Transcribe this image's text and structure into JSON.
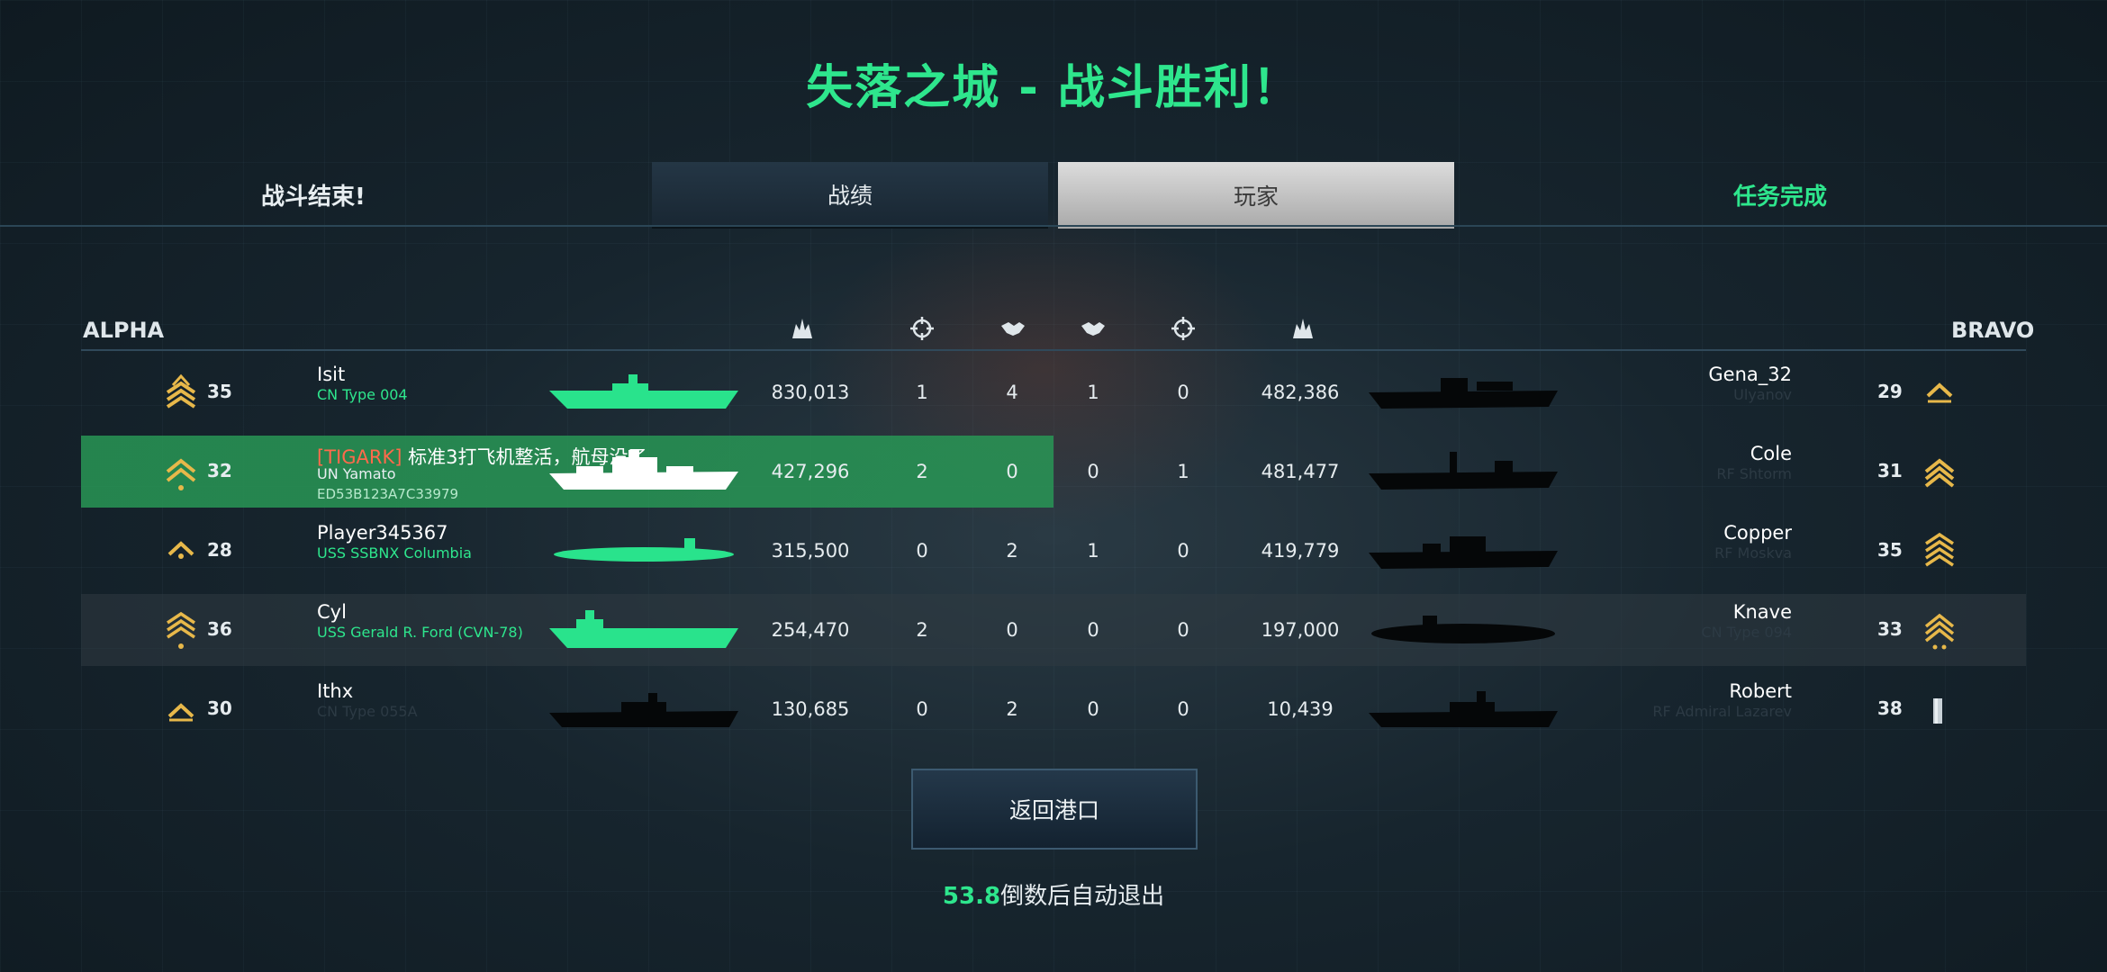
{
  "header": {
    "title": "失落之城 - 战斗胜利！",
    "left_status": "战斗结束!",
    "right_status": "任务完成",
    "tabs": [
      {
        "label": "战绩",
        "active": false
      },
      {
        "label": "玩家",
        "active": true
      }
    ]
  },
  "teams": {
    "left": "ALPHA",
    "right": "BRAVO"
  },
  "stat_icons": [
    "damage-icon",
    "kills-icon",
    "assists-icon",
    "assists-icon",
    "kills-icon",
    "damage-icon"
  ],
  "rows": [
    {
      "left": {
        "level": "35",
        "name": "Isit",
        "tag": "",
        "ship": "CN Type 004",
        "id": "",
        "damage": "830,013",
        "kills": "1",
        "assists": "4"
      },
      "right": {
        "level": "29",
        "name": "Gena_32",
        "ship": "Ulyanov",
        "damage": "482,386",
        "kills": "0",
        "assists": "1"
      }
    },
    {
      "left": {
        "level": "32",
        "name": "标准3打飞机整活，航母没了",
        "tag": "[TIGARK]",
        "ship": "UN Yamato",
        "id": "ED53B123A7C33979",
        "damage": "427,296",
        "kills": "2",
        "assists": "0"
      },
      "right": {
        "level": "31",
        "name": "Cole",
        "ship": "RF Shtorm",
        "damage": "481,477",
        "kills": "1",
        "assists": "0"
      }
    },
    {
      "left": {
        "level": "28",
        "name": "Player345367",
        "tag": "",
        "ship": "USS SSBNX Columbia",
        "id": "",
        "damage": "315,500",
        "kills": "0",
        "assists": "2"
      },
      "right": {
        "level": "35",
        "name": "Copper",
        "ship": "RF Moskva",
        "damage": "419,779",
        "kills": "0",
        "assists": "1"
      }
    },
    {
      "left": {
        "level": "36",
        "name": "Cyl",
        "tag": "",
        "ship": "USS Gerald R. Ford (CVN-78)",
        "id": "",
        "damage": "254,470",
        "kills": "2",
        "assists": "0"
      },
      "right": {
        "level": "33",
        "name": "Knave",
        "ship": "CN Type 094",
        "damage": "197,000",
        "kills": "0",
        "assists": "0"
      }
    },
    {
      "left": {
        "level": "30",
        "name": "Ithx",
        "tag": "",
        "ship": "CN Type 055A",
        "id": "",
        "damage": "130,685",
        "kills": "0",
        "assists": "2"
      },
      "right": {
        "level": "38",
        "name": "Robert",
        "ship": "RF Admiral Lazarev",
        "damage": "10,439",
        "kills": "0",
        "assists": "0"
      }
    }
  ],
  "footer": {
    "return_button": "返回港口",
    "countdown_seconds": "53.8",
    "countdown_text": "倒数后自动退出"
  },
  "colors": {
    "accent_green": "#2ee68d",
    "highlight_row": "#289655",
    "tag_red": "#ff6a4b"
  }
}
